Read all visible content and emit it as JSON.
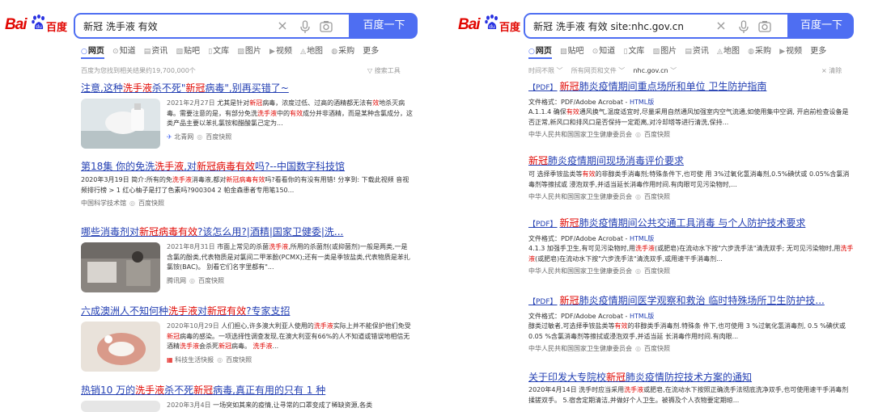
{
  "left": {
    "logo": {
      "bai": "Bai",
      "du": "百度"
    },
    "search": {
      "query": "新冠 洗手液 有效",
      "button": "百度一下"
    },
    "tabs": [
      "网页",
      "知道",
      "资讯",
      "贴吧",
      "文库",
      "图片",
      "视频",
      "地图",
      "采购",
      "更多"
    ],
    "meta": "百度为您找到相关结果约19,700,000个",
    "tool": "搜索工具",
    "results": [
      {
        "title": [
          "注意,这种",
          "洗手液",
          "杀不死\"",
          "新冠",
          "病毒\",别再买错了~"
        ],
        "date": "2021年2月27日",
        "abstract": [
          "尤其是针对",
          "新冠",
          "病毒，浓度过低、过高的酒精都无法有",
          "效",
          "地杀灭病毒。需要注意的是，有部分免洗",
          "洗手液",
          "中的",
          "有效",
          "成分并非酒精，而是某种含氯成分，这类产品主要以苯扎氯铵和醋酸氯己定为..."
        ],
        "source": "北青网",
        "snapshot": "百度快照"
      },
      {
        "title": [
          "第18集 你的免洗",
          "洗手液",
          ",对",
          "新冠",
          "病毒",
          "有效",
          "吗?--中国数字科技馆"
        ],
        "abstract": [
          "2020年3月19日 简介:所有的免",
          "洗手液",
          "消毒液,都对",
          "新冠",
          "病毒",
          "有效",
          "吗?看看你的有没有用错! 分享到: 下载此视频 音视频排行榜 > 1 红心柚子是打了色素吗?900304 2 帕金森患者专用笔150..."
        ],
        "source": "中国科学技术馆",
        "snapshot": "百度快照"
      },
      {
        "title": [
          "哪些消毒剂对",
          "新冠",
          "病毒",
          "有效",
          "?该怎么用?|酒精|国家卫健委|洗..."
        ],
        "date": "2021年8月31日",
        "abstract": [
          "市面上常见的杀菌",
          "洗手液",
          ",所用的杀菌剂(或抑菌剂)一般是两类,一是含氯的酚类,代表物质是对氯间二甲苯酚(PCMX);还有一类是季铵盐类,代表物质是苯扎氯铵(BAC)。 别看它们名字里都有\"..."
        ],
        "source": "腾讯网",
        "snapshot": "百度快照"
      },
      {
        "title": [
          "六成澳洲人不知何种",
          "洗手液",
          "对",
          "新冠",
          "有效",
          "?专家支招"
        ],
        "date": "2020年10月29日",
        "abstract": [
          "人们担心,许多澳大利亚人使用的",
          "洗手液",
          "实际上并不能保护他们免受",
          "新冠",
          "病毒的感染。一项选择性调查发现,在澳大利亚有66%的人不知道或错误地相信无酒精",
          "洗手液",
          "会杀死",
          "新冠",
          "病毒。 ",
          "洗手液",
          "..."
        ],
        "source": "科技生活快报",
        "snapshot": "百度快照"
      },
      {
        "title": [
          "热销10 万的",
          "洗手液",
          "杀不死",
          "新冠",
          "病毒,真正有用的只有 1 种"
        ],
        "date": "2020年3月4日",
        "abstract": [
          "一场突如其来的疫情,让寻常的口罩变成了稀缺资源,各类"
        ]
      }
    ]
  },
  "right": {
    "logo": {
      "bai": "Bai",
      "du": "百度"
    },
    "search": {
      "query": "新冠 洗手液 有效 site:nhc.gov.cn",
      "button": "百度一下"
    },
    "tabs": [
      "网页",
      "贴吧",
      "知道",
      "文库",
      "图片",
      "资讯",
      "地图",
      "采购",
      "视频",
      "更多"
    ],
    "filters": [
      "时间不限",
      "所有网页和文件",
      "nhc.gov.cn"
    ],
    "clear": "清除",
    "pdf_label": "【PDF】",
    "fmt_label": "文件格式：PDF/Adobe Acrobat - ",
    "html_label": "HTML版",
    "results": [
      {
        "pdf": true,
        "title": [
          "新冠",
          "肺炎疫情期间重点场所和单位 卫生防护指南"
        ],
        "abstract": [
          "A.1.1.4 确保",
          "有效",
          "通风换气,温度适宜时,尽量采用自然通风加强室内空气流通,如使用集中空调, 开启前检查设备是否正常,新风口和排风口是否保持一定距离,对冷却塔等进行清洗,保持..."
        ],
        "source": "中华人民共和国国家卫生健康委员会",
        "snapshot": "百度快照"
      },
      {
        "pdf": false,
        "title": [
          "新冠",
          "肺炎疫情期间现场消毒评价要求"
        ],
        "abstract": [
          "可 选择季铵盐类等",
          "有效",
          "的非醇类手消毒剂;特殊条件下,也可使 用 3%过氧化氢消毒剂,0.5%碘伏或 0.05%含氯消毒剂等擦拭或 浸泡双手,并适当延长消毒作用时间.有肉眼可见污染物时,..."
        ],
        "source": "中华人民共和国国家卫生健康委员会",
        "snapshot": "百度快照"
      },
      {
        "pdf": true,
        "title": [
          "新冠",
          "肺炎疫情期间公共交通工具消毒 与个人防护技术要求"
        ],
        "abstract": [
          "4.1.3 加强手卫生,有可见污染物时,用",
          "洗手液",
          "(或肥皂)在流动水下按\"六步洗手法\"清洗双手; 无可见污染物时,用",
          "洗手液",
          "(或肥皂)在流动水下按\"六步洗手法\"清洗双手,或用速干手消毒剂..."
        ],
        "source": "中华人民共和国国家卫生健康委员会",
        "snapshot": "百度快照"
      },
      {
        "pdf": true,
        "title": [
          "新冠",
          "肺炎疫情期间医学观察和救治 临时特殊场所卫生防护技..."
        ],
        "abstract": [
          "醇类过敏者,可选择季铵盐类等",
          "有效",
          "的非醇类手消毒剂.特殊条 件下,也可使用 3 %过氧化氢消毒剂, 0.5 %碘伏或 0.05 %含氯消毒剂等擦拭或浸泡双手,并适当延 长消毒作用时间.有肉眼..."
        ],
        "source": "中华人民共和国国家卫生健康委员会",
        "snapshot": "百度快照"
      },
      {
        "pdf": false,
        "title": [
          "关于印发大专院校",
          "新冠",
          "肺炎疫情防控技术方案的通知"
        ],
        "abstract": [
          "2020年4月14日 洗手时应当采用",
          "洗手液",
          "或肥皂,在流动水下按照正确洗手法彻底洗净双手,也可使用速干手消毒剂揉搓双手。 5.宿舍定期清洁,并做好个人卫生。被褥及个人衣物要定期晾..."
        ]
      }
    ]
  }
}
